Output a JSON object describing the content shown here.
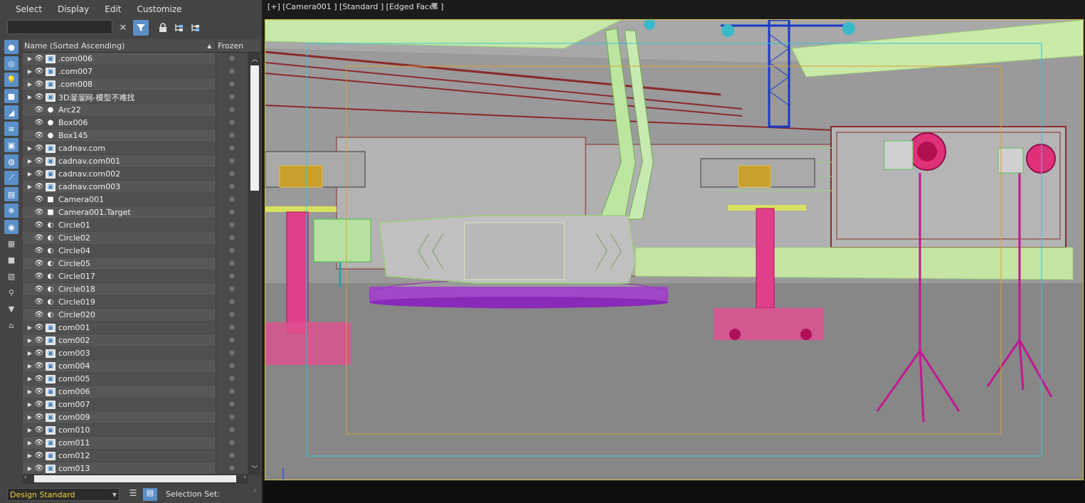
{
  "menu": [
    "Select",
    "Display",
    "Edit",
    "Customize"
  ],
  "search": {
    "value": "",
    "placeholder": ""
  },
  "list_header": {
    "name": "Name (Sorted Ascending)",
    "frozen": "Frozen"
  },
  "rows": [
    {
      "name": ".com006",
      "type": "group",
      "expandable": true
    },
    {
      "name": ".com007",
      "type": "group",
      "expandable": true
    },
    {
      "name": ".com008",
      "type": "group",
      "expandable": true
    },
    {
      "name": "3D溜溜网-模型不难找",
      "type": "group",
      "expandable": true
    },
    {
      "name": "Arc22",
      "type": "shape",
      "expandable": false
    },
    {
      "name": "Box006",
      "type": "shape",
      "expandable": false
    },
    {
      "name": "Box145",
      "type": "shape",
      "expandable": false
    },
    {
      "name": "cadnav.com",
      "type": "group",
      "expandable": true
    },
    {
      "name": "cadnav.com001",
      "type": "group",
      "expandable": true
    },
    {
      "name": "cadnav.com002",
      "type": "group",
      "expandable": true
    },
    {
      "name": "cadnav.com003",
      "type": "group",
      "expandable": true
    },
    {
      "name": "Camera001",
      "type": "camera",
      "expandable": false
    },
    {
      "name": "Camera001.Target",
      "type": "camera",
      "expandable": false
    },
    {
      "name": "Circle01",
      "type": "spline",
      "expandable": false
    },
    {
      "name": "Circle02",
      "type": "spline",
      "expandable": false
    },
    {
      "name": "Circle04",
      "type": "spline",
      "expandable": false
    },
    {
      "name": "Circle05",
      "type": "spline",
      "expandable": false
    },
    {
      "name": "Circle017",
      "type": "spline",
      "expandable": false
    },
    {
      "name": "Circle018",
      "type": "spline",
      "expandable": false
    },
    {
      "name": "Circle019",
      "type": "spline",
      "expandable": false
    },
    {
      "name": "Circle020",
      "type": "spline",
      "expandable": false
    },
    {
      "name": "com001",
      "type": "group",
      "expandable": true
    },
    {
      "name": "com002",
      "type": "group",
      "expandable": true
    },
    {
      "name": "com003",
      "type": "group",
      "expandable": true
    },
    {
      "name": "com004",
      "type": "group",
      "expandable": true
    },
    {
      "name": "com005",
      "type": "group",
      "expandable": true
    },
    {
      "name": "com006",
      "type": "group",
      "expandable": true
    },
    {
      "name": "com007",
      "type": "group",
      "expandable": true
    },
    {
      "name": "com009",
      "type": "group",
      "expandable": true
    },
    {
      "name": "com010",
      "type": "group",
      "expandable": true
    },
    {
      "name": "com011",
      "type": "group",
      "expandable": true
    },
    {
      "name": "com012",
      "type": "group",
      "expandable": true
    },
    {
      "name": "com013",
      "type": "group",
      "expandable": true
    }
  ],
  "bottom": {
    "workspace": "Design Standard",
    "selection_set_label": "Selection Set:"
  },
  "viewport": {
    "label": "[+] [Camera001 ] [Standard ] [Edged Faces ]"
  },
  "colors": {
    "accent": "#5b8fc7",
    "workspace_text": "#f0d23c",
    "viewport_border": "#d6c24a"
  },
  "icons": {
    "eye": "eye-icon",
    "frozen": "snowflake-icon",
    "filter": "funnel-icon",
    "lock": "lock-icon"
  }
}
